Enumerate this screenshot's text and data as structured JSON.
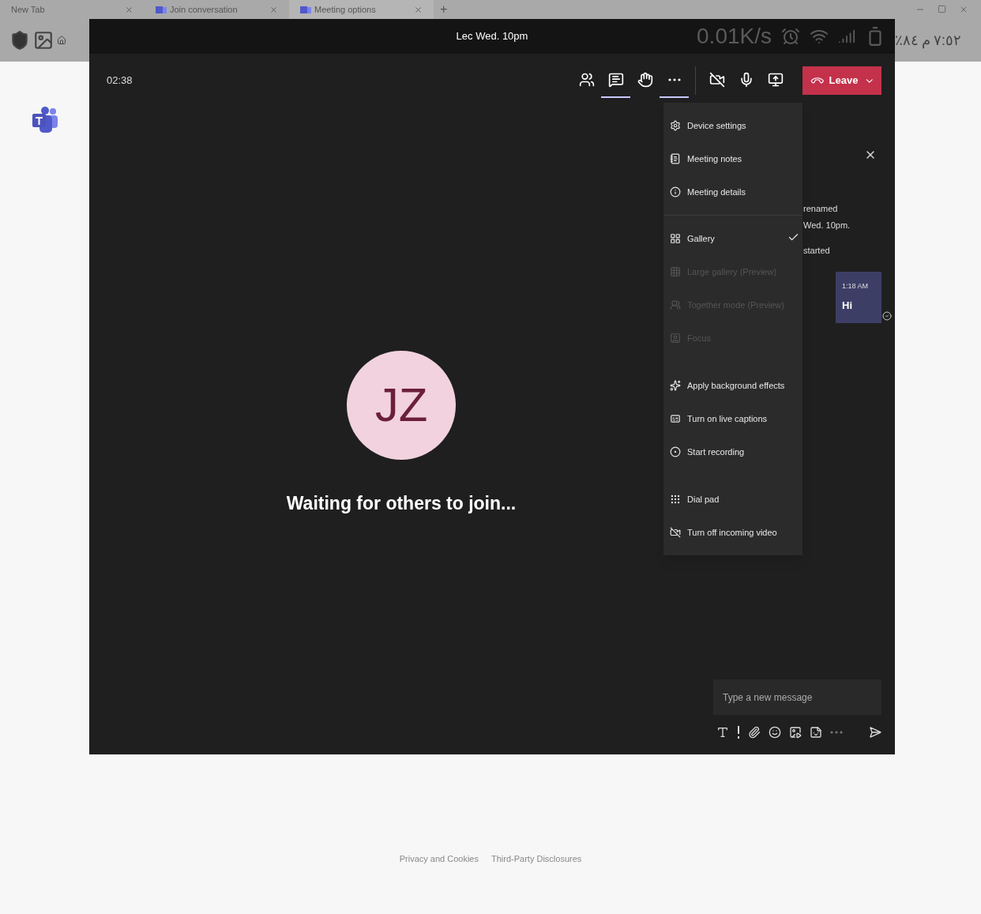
{
  "browser": {
    "tabs": [
      {
        "label": "New Tab",
        "selected": false
      },
      {
        "label": "Join conversation",
        "selected": false
      },
      {
        "label": "Meeting options",
        "selected": true
      }
    ],
    "new_tab": "+",
    "status": [
      "٧:٥٢",
      "م",
      "٪٨٤"
    ]
  },
  "meeting": {
    "title": "Lec Wed. 10pm",
    "net_speed": "0.01K/s",
    "timer": "02:38",
    "toolbar": [
      {
        "kind": "people",
        "selected": false
      },
      {
        "kind": "chat",
        "selected": true
      },
      {
        "kind": "hand",
        "selected": false
      },
      {
        "kind": "more",
        "selected": true
      },
      {
        "kind": "camera",
        "selected": false
      },
      {
        "kind": "mic",
        "selected": false
      },
      {
        "kind": "share",
        "selected": false
      }
    ],
    "leave": "Leave",
    "avatar": {
      "initials": "JZ"
    },
    "waiting": "Waiting for others to join...",
    "menu": {
      "groups": [
        [
          {
            "label": "Device settings",
            "disabled": false,
            "checked": false
          },
          {
            "label": "Meeting notes",
            "disabled": false,
            "checked": false
          },
          {
            "label": "Meeting details",
            "disabled": false,
            "checked": false
          }
        ],
        [
          {
            "label": "Gallery",
            "disabled": false,
            "checked": true
          },
          {
            "label": "Large gallery (Preview)",
            "disabled": true,
            "checked": false
          },
          {
            "label": "Together mode (Preview)",
            "disabled": true,
            "checked": false
          },
          {
            "label": "Focus",
            "disabled": true,
            "checked": false
          }
        ],
        [
          {
            "label": "Apply background effects",
            "disabled": false,
            "checked": false
          },
          {
            "label": "Turn on live captions",
            "disabled": false,
            "checked": false
          },
          {
            "label": "Start recording",
            "disabled": false,
            "checked": false
          }
        ],
        [
          {
            "label": "Dial pad",
            "disabled": false,
            "checked": false
          },
          {
            "label": "Turn off incoming video",
            "disabled": false,
            "checked": false
          }
        ]
      ]
    },
    "chat": {
      "events": [
        "renamed",
        "Wed. 10pm.",
        "started"
      ],
      "message": {
        "time": "1:18 AM",
        "text": "Hi"
      },
      "compose": {
        "placeholder": "Type a new message"
      }
    }
  },
  "footer": {
    "links": [
      "Privacy and Cookies",
      "Third-Party Disclosures"
    ]
  }
}
